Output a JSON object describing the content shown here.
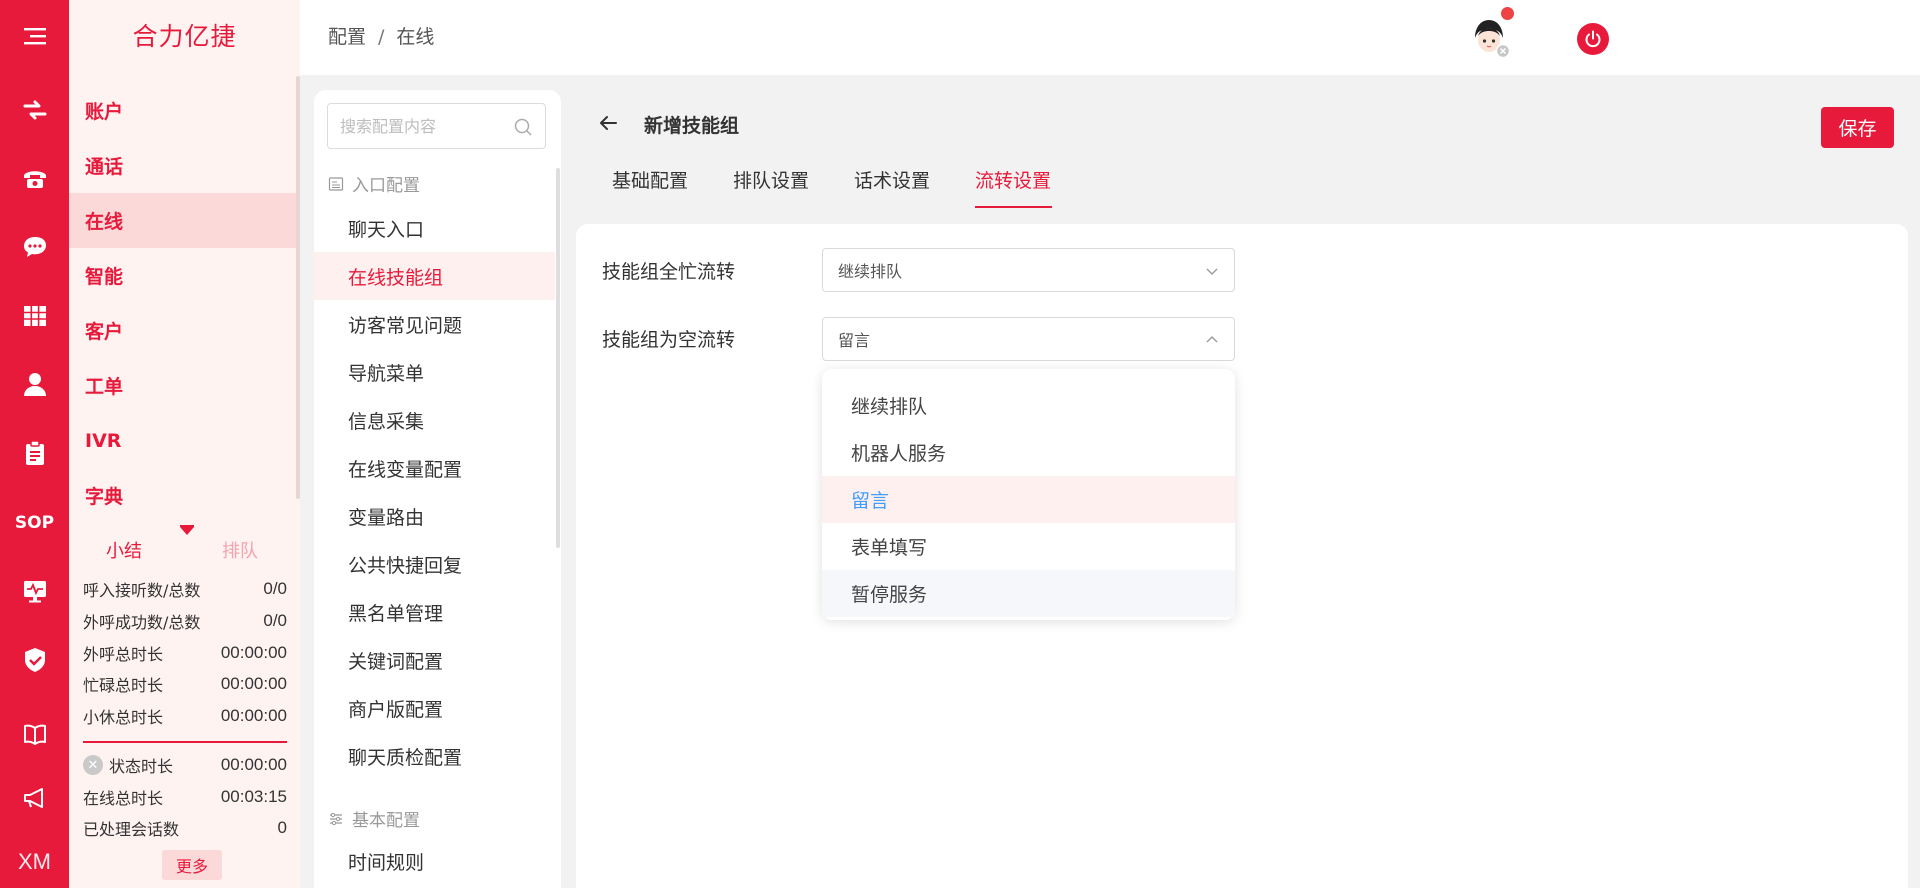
{
  "app": {
    "brand": "合力亿捷"
  },
  "rail": {
    "icons": [
      "menu-icon",
      "transfer-icon",
      "phone-icon",
      "chat-icon",
      "grid-icon",
      "user-icon",
      "clipboard-icon",
      "sop-icon",
      "monitor-icon",
      "shield-icon",
      "book-icon",
      "megaphone-icon",
      "xm-icon"
    ],
    "sop_label": "SOP",
    "xm_label": "XM"
  },
  "nav": {
    "items": [
      {
        "label": "账户"
      },
      {
        "label": "通话"
      },
      {
        "label": "在线"
      },
      {
        "label": "智能"
      },
      {
        "label": "客户"
      },
      {
        "label": "工单"
      },
      {
        "label": "IVR"
      },
      {
        "label": "字典"
      }
    ],
    "active_index": 2
  },
  "stats": {
    "tabs": [
      "小结",
      "排队"
    ],
    "rows": [
      {
        "label": "呼入接听数/总数",
        "value": "0/0"
      },
      {
        "label": "外呼成功数/总数",
        "value": "0/0"
      },
      {
        "label": "外呼总时长",
        "value": "00:00:00"
      },
      {
        "label": "忙碌总时长",
        "value": "00:00:00"
      },
      {
        "label": "小休总时长",
        "value": "00:00:00"
      },
      {
        "label": "状态时长",
        "value": "00:00:00"
      },
      {
        "label": "在线总时长",
        "value": "00:03:15"
      },
      {
        "label": "已处理会话数",
        "value": "0"
      }
    ],
    "more_label": "更多"
  },
  "header": {
    "breadcrumb": [
      "配置",
      "在线"
    ],
    "separator": "/"
  },
  "config": {
    "search_placeholder": "搜索配置内容",
    "group1_title": "入口配置",
    "group1_items": [
      "聊天入口",
      "在线技能组",
      "访客常见问题",
      "导航菜单",
      "信息采集",
      "在线变量配置",
      "变量路由",
      "公共快捷回复",
      "黑名单管理",
      "关键词配置",
      "商户版配置",
      "聊天质检配置"
    ],
    "group2_title": "基本配置",
    "group2_items": [
      "时间规则"
    ],
    "active": "在线技能组"
  },
  "main": {
    "title": "新增技能组",
    "save_label": "保存",
    "tabs": [
      "基础配置",
      "排队设置",
      "话术设置",
      "流转设置"
    ],
    "active_tab": "流转设置",
    "form": {
      "busy_label": "技能组全忙流转",
      "busy_value": "继续排队",
      "empty_label": "技能组为空流转",
      "empty_value": "留言"
    },
    "dropdown_options": [
      "继续排队",
      "机器人服务",
      "留言",
      "表单填写",
      "暂停服务"
    ],
    "dropdown_selected": "留言",
    "dropdown_hover": "暂停服务"
  },
  "colors": {
    "brand": "#e81a3b",
    "selected_option": "#409eff"
  }
}
